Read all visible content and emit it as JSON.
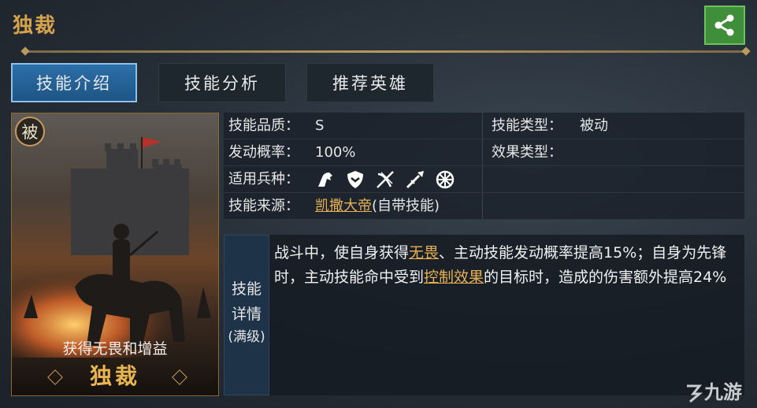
{
  "header": {
    "title": "独裁"
  },
  "tabs": [
    {
      "label": "技能介绍",
      "active": true
    },
    {
      "label": "技能分析",
      "active": false
    },
    {
      "label": "推荐英雄",
      "active": false
    }
  ],
  "card": {
    "badge": "被",
    "subtitle": "获得无畏和增益",
    "name": "独裁"
  },
  "info": {
    "quality_label": "技能品质：",
    "quality_value": "S",
    "type_label": "技能类型：",
    "type_value": "被动",
    "rate_label": "发动概率：",
    "rate_value": "100%",
    "effect_label": "效果类型：",
    "effect_value": "",
    "troops_label": "适用兵种：",
    "troop_icons": [
      "cavalry-horse-icon",
      "shield-infantry-icon",
      "crossbow-icon",
      "spear-icon",
      "siege-wheel-icon"
    ],
    "source_label": "技能来源：",
    "source_hero": "凯撒大帝",
    "source_suffix": "(自带技能)"
  },
  "detail": {
    "label_line1": "技能",
    "label_line2": "详情",
    "label_line3": "(满级)",
    "text_1": "战斗中，使自身获得",
    "link_1": "无畏",
    "text_2": "、主动技能发动概率提高15%；自身为先锋时，主动技能命中受到",
    "link_2": "控制效果",
    "text_3": "的目标时，造成的伤害额外提高24%"
  },
  "watermark": "九游",
  "colors": {
    "accent_gold": "#d6a24c",
    "tab_active": "#2c6fa8",
    "link": "#e7b053",
    "share_green": "#3f8f3a"
  }
}
